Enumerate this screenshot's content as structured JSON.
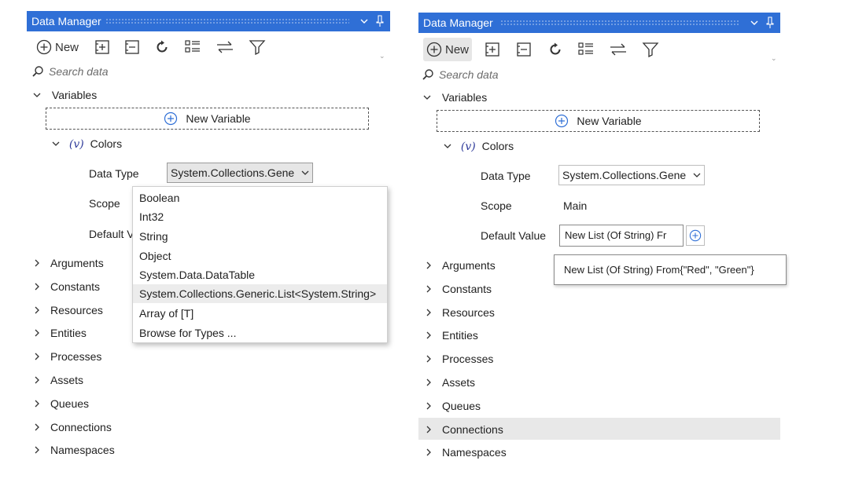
{
  "left": {
    "title": "Data Manager",
    "pin_icon": "pin-icon",
    "dropdown_caret": "⌄",
    "toolbar": {
      "new_label": "New"
    },
    "search_placeholder": "Search data",
    "variables_label": "Variables",
    "new_variable_label": "New Variable",
    "variable_prefix": "(v)",
    "variable_name": "Colors",
    "data_type_label": "Data Type",
    "data_type_value": "System.Collections.Gene",
    "scope_label": "Scope",
    "default_label": "Default V",
    "type_options": [
      "Boolean",
      "Int32",
      "String",
      "Object",
      "System.Data.DataTable",
      "System.Collections.Generic.List<System.String>",
      "Array of [T]",
      "Browse for Types ..."
    ],
    "sections": [
      "Arguments",
      "Constants",
      "Resources",
      "Entities",
      "Processes",
      "Assets",
      "Queues",
      "Connections",
      "Namespaces"
    ]
  },
  "right": {
    "title": "Data Manager",
    "toolbar": {
      "new_label": "New"
    },
    "search_placeholder": "Search data",
    "variables_label": "Variables",
    "new_variable_label": "New Variable",
    "variable_prefix": "(v)",
    "variable_name": "Colors",
    "data_type_label": "Data Type",
    "data_type_value": "System.Collections.Gene",
    "scope_label": "Scope",
    "scope_value": "Main",
    "default_label": "Default Value",
    "default_value": "New List (Of String) Fr",
    "tooltip": "New List (Of String) From{\"Red\", \"Green\"}",
    "sections": [
      "Arguments",
      "Constants",
      "Resources",
      "Entities",
      "Processes",
      "Assets",
      "Queues",
      "Connections",
      "Namespaces"
    ]
  },
  "colors": {
    "titlebar": "#2f6fd6",
    "highlight": "#e8e8e8"
  }
}
